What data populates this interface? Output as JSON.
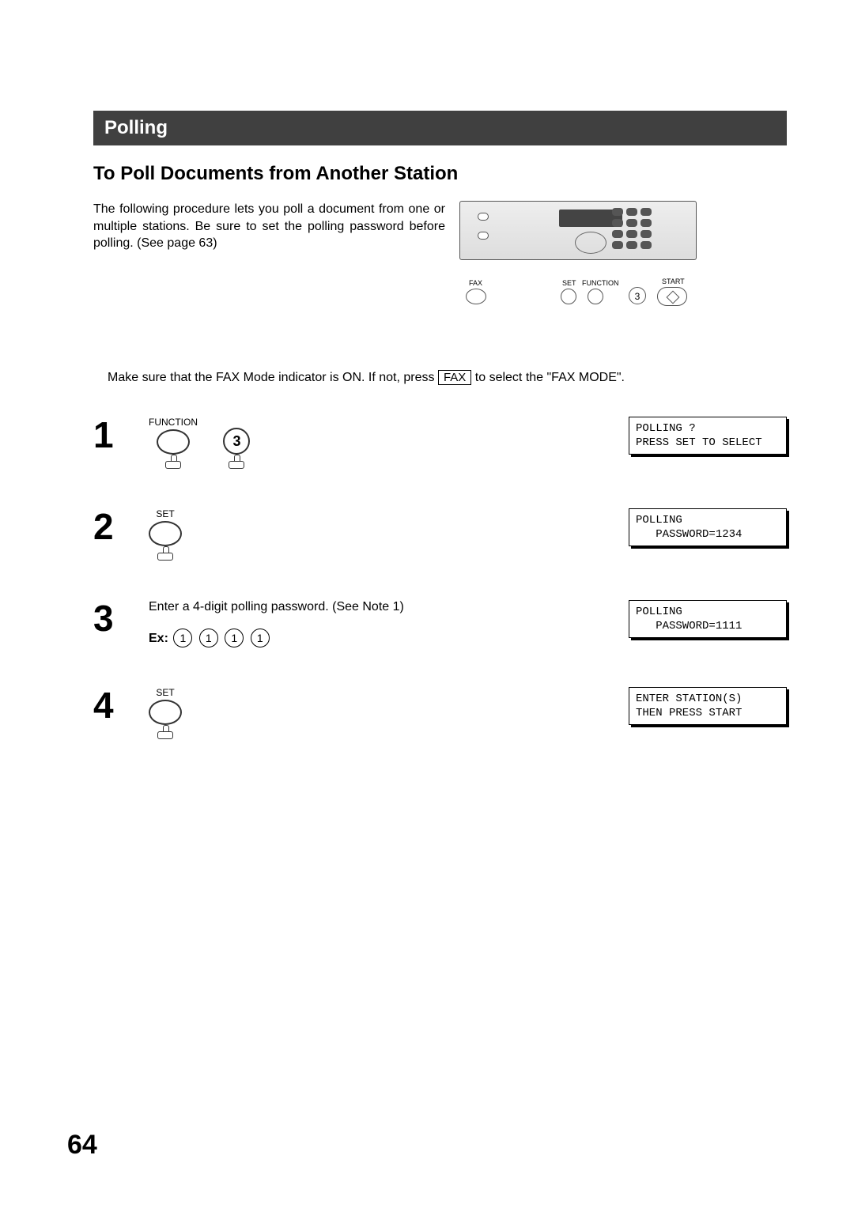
{
  "section_title": "Polling",
  "subheading": "To Poll Documents from Another Station",
  "intro_text": "The following procedure lets you poll a document from one or multiple stations.  Be sure to set the polling password before polling.  (See page 63)",
  "panel_labels": {
    "fax": "FAX",
    "set": "SET",
    "function": "FUNCTION",
    "start": "START",
    "key3": "3"
  },
  "mode_line": {
    "pre": "Make sure that the FAX Mode indicator is ON.  If not, press ",
    "btn": "FAX",
    "post": " to select the \"FAX MODE\"."
  },
  "steps": [
    {
      "num": "1",
      "btn1_label": "FUNCTION",
      "key": "3",
      "lcd": "POLLING ?\nPRESS SET TO SELECT"
    },
    {
      "num": "2",
      "btn1_label": "SET",
      "lcd": "POLLING\n   PASSWORD=1234"
    },
    {
      "num": "3",
      "text": "Enter a 4-digit polling password. (See Note 1)",
      "ex_label": "Ex:",
      "ex_digits": [
        "1",
        "1",
        "1",
        "1"
      ],
      "lcd": "POLLING\n   PASSWORD=1111"
    },
    {
      "num": "4",
      "btn1_label": "SET",
      "lcd": "ENTER STATION(S)\nTHEN PRESS START"
    }
  ],
  "page_number": "64"
}
